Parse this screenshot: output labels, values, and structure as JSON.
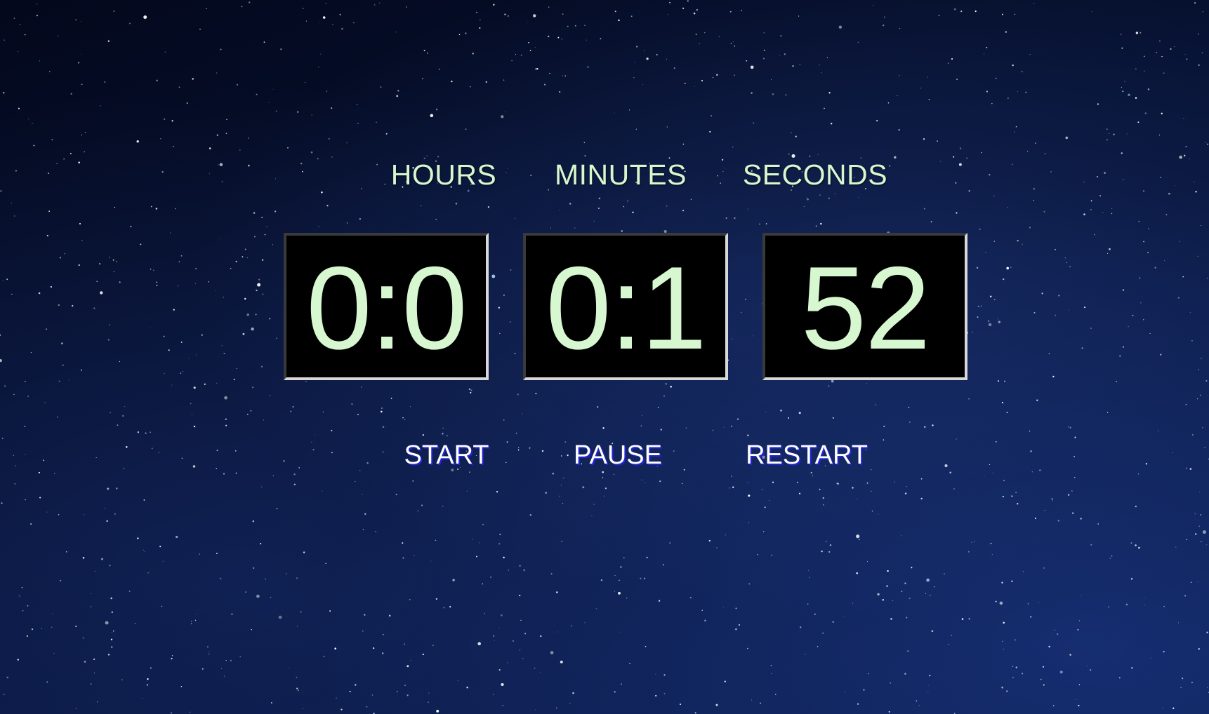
{
  "timer": {
    "labels": {
      "hours": "HOURS",
      "minutes": "MINUTES",
      "seconds": "SECONDS"
    },
    "display": {
      "hours": "0:0",
      "minutes": "0:1",
      "seconds": "52"
    }
  },
  "controls": {
    "start": "START",
    "pause": "PAUSE",
    "restart": "RESTART"
  },
  "colors": {
    "digit_text": "#d6f7cf",
    "button_shadow": "#2323d9",
    "background": "#071233"
  },
  "background_image": "starry-night-sky"
}
